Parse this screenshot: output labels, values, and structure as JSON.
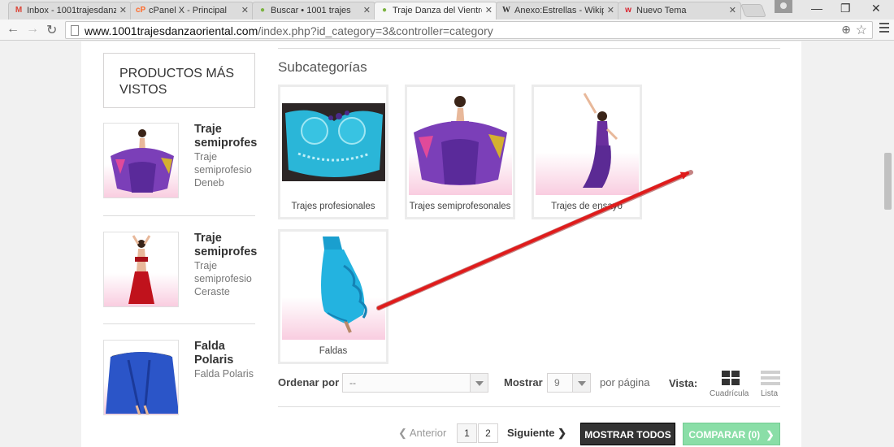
{
  "browser": {
    "tabs": [
      {
        "label": "Inbox - 1001trajesdanz",
        "favicon": "gmail-icon",
        "color": "#db4437"
      },
      {
        "label": "cPanel X - Principal",
        "favicon": "cpanel-icon",
        "color": "#ff6c2c"
      },
      {
        "label": "Buscar • 1001 trajes",
        "favicon": "prestashop-icon",
        "color": "#7cb342"
      },
      {
        "label": "Traje Danza del Vientre",
        "favicon": "prestashop-icon",
        "color": "#7cb342"
      },
      {
        "label": "Anexo:Estrellas - Wikip",
        "favicon": "wikipedia-icon",
        "color": "#333333"
      },
      {
        "label": "Nuevo Tema",
        "favicon": "forum-icon",
        "color": "#d9232e"
      }
    ],
    "url_host": "www.1001trajesdanzaoriental.com",
    "url_path": "/index.php?id_category=3&controller=category"
  },
  "sidebar": {
    "title": "PRODUCTOS MÁS VISTOS",
    "items": [
      {
        "name": "Traje semiprofes",
        "desc_line1": "Traje",
        "desc_line2": "semiprofesio",
        "desc_line3": "Deneb"
      },
      {
        "name": "Traje semiprofes",
        "desc_line1": "Traje",
        "desc_line2": "semiprofesio",
        "desc_line3": "Ceraste"
      },
      {
        "name": "Falda Polaris",
        "desc_line1": "Falda Polaris"
      }
    ]
  },
  "main": {
    "subcategories_title": "Subcategorías",
    "subcategories": [
      {
        "label": "Trajes profesionales"
      },
      {
        "label": "Trajes semiprofesonales"
      },
      {
        "label": "Trajes de ensayo"
      },
      {
        "label": "Faldas"
      }
    ],
    "toolbar": {
      "sort_label": "Ordenar por",
      "sort_value": "--",
      "show_label": "Mostrar",
      "show_value": "9",
      "per_page_label": "por página",
      "view_label": "Vista:",
      "grid_label": "Cuadrícula",
      "list_label": "Lista"
    },
    "pagination": {
      "prev": "Anterior",
      "pages": [
        "1",
        "2"
      ],
      "next": "Siguiente",
      "show_all": "MOSTRAR TODOS",
      "compare": "COMPARAR (0)"
    }
  },
  "colors": {
    "accent_green": "#76d998",
    "annotation_red": "#e01b1b"
  }
}
